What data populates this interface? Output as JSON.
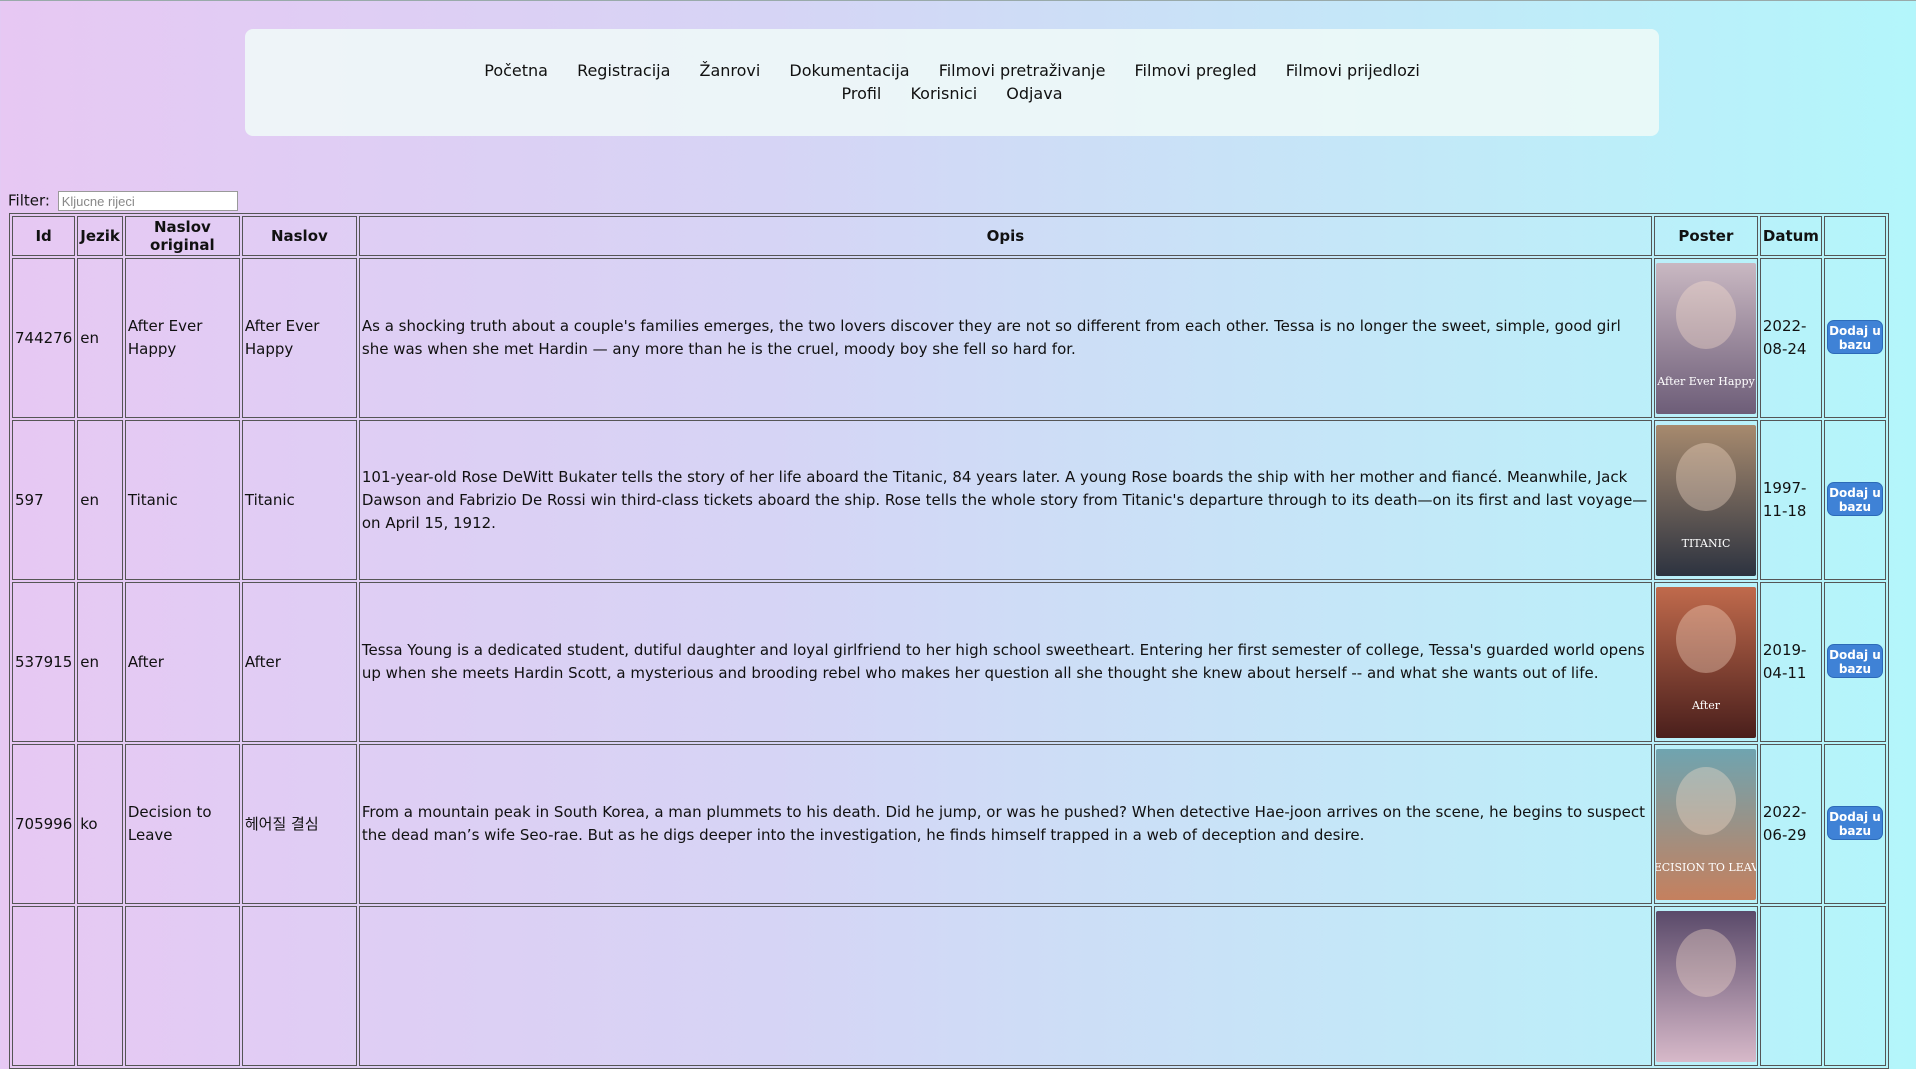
{
  "nav": {
    "row1": [
      "Početna",
      "Registracija",
      "Žanrovi",
      "Dokumentacija",
      "Filmovi pretraživanje",
      "Filmovi pregled",
      "Filmovi prijedlozi"
    ],
    "row2": [
      "Profil",
      "Korisnici",
      "Odjava"
    ]
  },
  "filter": {
    "label": "Filter:",
    "placeholder": "Kljucne rijeci"
  },
  "table": {
    "headers": [
      "Id",
      "Jezik",
      "Naslov original",
      "Naslov",
      "Opis",
      "Poster",
      "Datum",
      ""
    ],
    "button_label": "Dodaj u bazu",
    "rows": [
      {
        "id": "744276",
        "jezik": "en",
        "naslov_original": "After Ever Happy",
        "naslov": "After Ever Happy",
        "opis": "As a shocking truth about a couple's families emerges, the two lovers discover they are not so different from each other. Tessa is no longer the sweet, simple, good girl she was when she met Hardin — any more than he is the cruel, moody boy she fell so hard for.",
        "poster_text": "After Ever Happy",
        "poster_colors": [
          "#c9b8c2",
          "#6d5d78"
        ],
        "datum": "2022-08-24"
      },
      {
        "id": "597",
        "jezik": "en",
        "naslov_original": "Titanic",
        "naslov": "Titanic",
        "opis": "101-year-old Rose DeWitt Bukater tells the story of her life aboard the Titanic, 84 years later. A young Rose boards the ship with her mother and fiancé. Meanwhile, Jack Dawson and Fabrizio De Rossi win third-class tickets aboard the ship. Rose tells the whole story from Titanic's departure through to its death—on its first and last voyage—on April 15, 1912.",
        "poster_text": "TITANIC",
        "poster_colors": [
          "#a78a6e",
          "#2d3340"
        ],
        "datum": "1997-11-18"
      },
      {
        "id": "537915",
        "jezik": "en",
        "naslov_original": "After",
        "naslov": "After",
        "opis": "Tessa Young is a dedicated student, dutiful daughter and loyal girlfriend to her high school sweetheart. Entering her first semester of college, Tessa's guarded world opens up when she meets Hardin Scott, a mysterious and brooding rebel who makes her question all she thought she knew about herself -- and what she wants out of life.",
        "poster_text": "After",
        "poster_colors": [
          "#c06a4c",
          "#4a1f1c"
        ],
        "datum": "2019-04-11"
      },
      {
        "id": "705996",
        "jezik": "ko",
        "naslov_original": "Decision to Leave",
        "naslov": "헤어질 결심",
        "opis": "From a mountain peak in South Korea, a man plummets to his death. Did he jump, or was he pushed? When detective Hae-joon arrives on the scene, he begins to suspect the dead man’s wife Seo-rae. But as he digs deeper into the investigation, he finds himself trapped in a web of deception and desire.",
        "poster_text": "DECISION TO LEAVE",
        "poster_colors": [
          "#6fa4b0",
          "#c5805e"
        ],
        "datum": "2022-06-29"
      },
      {
        "id": "",
        "jezik": "",
        "naslov_original": "",
        "naslov": "",
        "opis": "",
        "poster_text": "",
        "poster_colors": [
          "#5a4a6a",
          "#d7b9c9"
        ],
        "datum": ""
      }
    ]
  }
}
